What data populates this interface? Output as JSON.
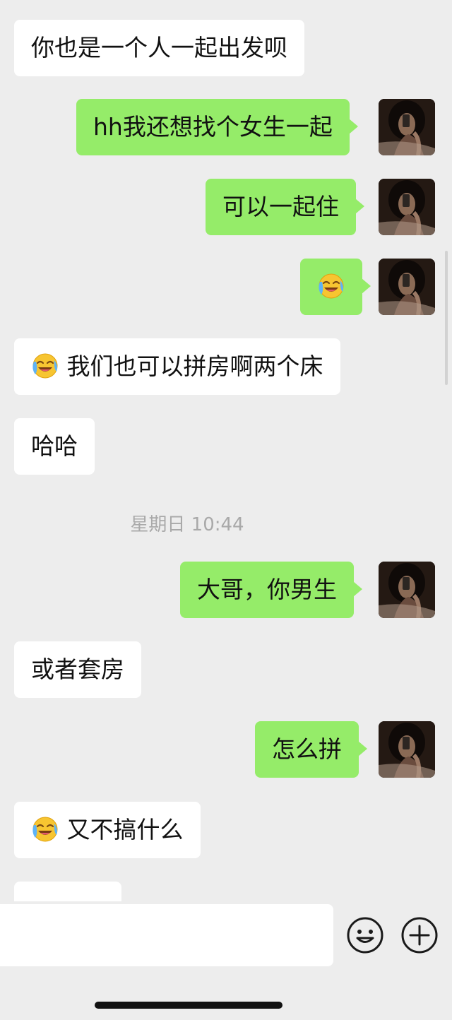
{
  "messages": [
    {
      "side": "in",
      "text": "你也是一个人一起出发呗",
      "emoji_prefix": false
    },
    {
      "side": "out",
      "text": "hh我还想找个女生一起",
      "emoji_prefix": false
    },
    {
      "side": "out",
      "text": "可以一起住",
      "emoji_prefix": false
    },
    {
      "side": "out",
      "text": "",
      "emoji_prefix": true
    },
    {
      "side": "in",
      "text": "我们也可以拼房啊两个床",
      "emoji_prefix": true
    },
    {
      "side": "in",
      "text": "哈哈",
      "emoji_prefix": false
    },
    {
      "side": "out",
      "text": "大哥，你男生",
      "emoji_prefix": false
    },
    {
      "side": "in",
      "text": "或者套房",
      "emoji_prefix": false
    },
    {
      "side": "out",
      "text": "怎么拼",
      "emoji_prefix": false
    },
    {
      "side": "in",
      "text": "又不搞什么",
      "emoji_prefix": true
    }
  ],
  "timestamp": "星期日 10:44",
  "input": {
    "placeholder": ""
  },
  "icons": {
    "message_emoji": "crying-laughing-emoji-icon",
    "emoji_button": "smiley-face-icon",
    "more_button": "plus-circle-icon"
  },
  "colors": {
    "background": "#ededed",
    "outgoing_bubble": "#95ec69",
    "incoming_bubble": "#ffffff",
    "timestamp": "#a9a9a9"
  }
}
